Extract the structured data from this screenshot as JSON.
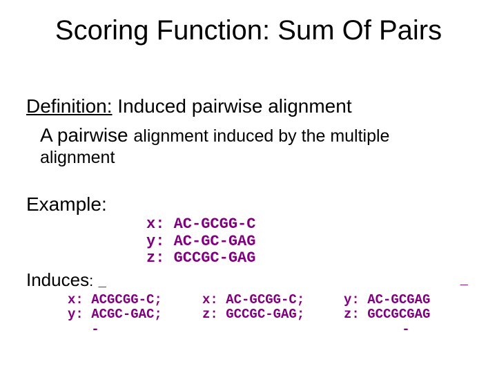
{
  "title": "Scoring Function: Sum Of Pairs",
  "definition": {
    "label": "Definition:",
    "term": " Induced pairwise alignment",
    "body_lead": "A pairwise ",
    "body_rest": "alignment induced by the multiple alignment"
  },
  "example_label": "Example:",
  "msa": "x: AC-GCGG-C\ny: AC-GC-GAG\nz: GCCGC-GAG",
  "induces_label": "Induces",
  "pairs": {
    "top": {
      "c1": "_",
      "c2": "",
      "c3": "_"
    },
    "row1": {
      "c1": "x: ACGCGG-C;",
      "c2": "x: AC-GCGG-C;",
      "c3": "y: AC-GCGAG"
    },
    "row2": {
      "c1": "y: ACGC-GAC;",
      "c2": "z: GCCGC-GAG;",
      "c3": "z: GCCGCGAG"
    },
    "bot": {
      "c1": "-",
      "c2": "",
      "c3": "-"
    }
  }
}
